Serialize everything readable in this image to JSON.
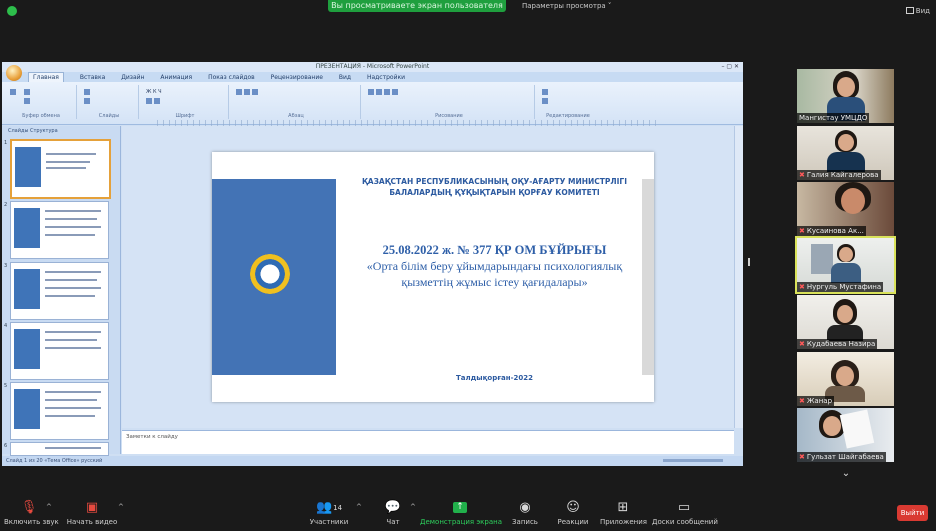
{
  "top_bar": {
    "share_banner": "Вы просматриваете экран пользователя",
    "view_options": "Параметры просмотра ˅",
    "view_button": "Вид"
  },
  "powerpoint": {
    "title": "ПРЕЗЕНТАЦИЯ - Microsoft PowerPoint",
    "tabs": [
      "Главная",
      "Вставка",
      "Дизайн",
      "Анимация",
      "Показ слайдов",
      "Рецензирование",
      "Вид",
      "Надстройки"
    ],
    "ribbon_groups": [
      "Буфер обмена",
      "Слайды",
      "Шрифт",
      "Абзац",
      "Рисование",
      "Редактирование"
    ],
    "left_tabs": "Слайды   Структура",
    "thumbnail_numbers": [
      "1",
      "2",
      "3",
      "4",
      "5",
      "6"
    ],
    "notes_placeholder": "Заметки к слайду",
    "status_text": "Слайд 1 из 20   «Тема Office»   русский",
    "slide": {
      "ministry": "ҚАЗАҚСТАН РЕСПУБЛИКАСЫНЫҢ ОҚУ-АҒАРТУ МИНИСТРЛІГІ\nБАЛАЛАРДЫҢ ҚҰҚЫҚТАРЫН ҚОРҒАУ КОМИТЕТІ",
      "order_number": "25.08.2022 ж. № 377 ҚР ОМ БҰЙРЫҒЫ",
      "order_title": "«Орта білім беру ұйымдарындағы психологиялық қызметтің жұмыс істеу қағидалары»",
      "year": "Талдықорған-2022"
    }
  },
  "participants": [
    {
      "name": "Мангистау УМЦДО",
      "muted": false
    },
    {
      "name": "Галия Кайгалерова",
      "muted": true
    },
    {
      "name": "Кусаинова Ак...",
      "muted": true
    },
    {
      "name": "Нургуль Мустафина",
      "muted": true
    },
    {
      "name": "Кудабаева Назира",
      "muted": true
    },
    {
      "name": "Жанар",
      "muted": true
    },
    {
      "name": "Гульзат Шайгабаева",
      "muted": true
    }
  ],
  "toolbar": {
    "unmute": "Включить звук",
    "start_video": "Начать видео",
    "participants": "Участники",
    "participants_count": "14",
    "chat": "Чат",
    "share_screen": "Демонстрация экрана",
    "record": "Запись",
    "reactions": "Реакции",
    "apps": "Приложения",
    "whiteboard": "Доски сообщений",
    "leave": "Выйти"
  },
  "colors": {
    "share_green": "#1f9f3e",
    "leave_red": "#d93a32",
    "slide_blue": "#4373b5",
    "speaking_outline": "#d9e25a"
  }
}
